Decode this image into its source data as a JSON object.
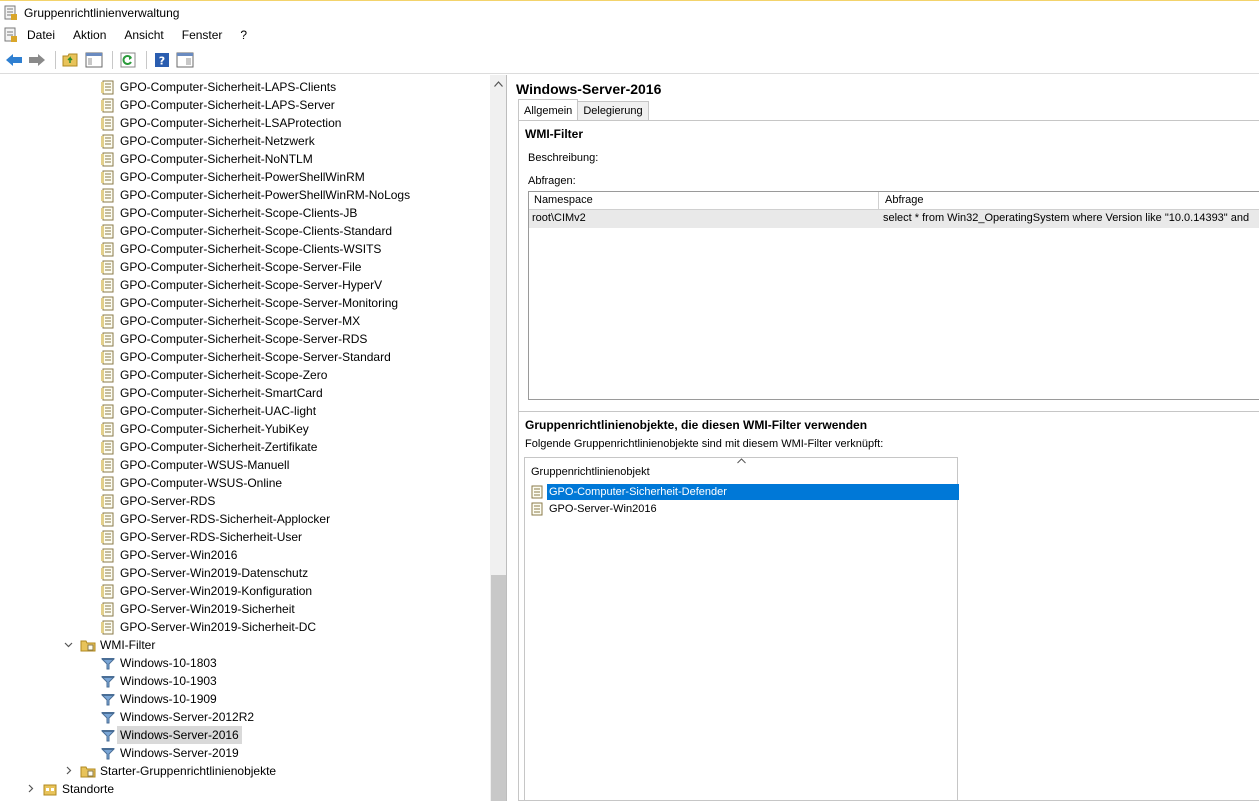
{
  "window": {
    "title": "Gruppenrichtlinienverwaltung"
  },
  "menu": [
    "Datei",
    "Aktion",
    "Ansicht",
    "Fenster",
    "?"
  ],
  "toolbar": {
    "buttons": [
      "back-icon",
      "forward-icon",
      "folder-up-icon",
      "show-hide-tree-icon",
      "refresh-icon",
      "help-icon",
      "properties-pane-icon"
    ]
  },
  "tree": {
    "gpos": [
      "GPO-Computer-Sicherheit-LAPS-Clients",
      "GPO-Computer-Sicherheit-LAPS-Server",
      "GPO-Computer-Sicherheit-LSAProtection",
      "GPO-Computer-Sicherheit-Netzwerk",
      "GPO-Computer-Sicherheit-NoNTLM",
      "GPO-Computer-Sicherheit-PowerShellWinRM",
      "GPO-Computer-Sicherheit-PowerShellWinRM-NoLogs",
      "GPO-Computer-Sicherheit-Scope-Clients-JB",
      "GPO-Computer-Sicherheit-Scope-Clients-Standard",
      "GPO-Computer-Sicherheit-Scope-Clients-WSITS",
      "GPO-Computer-Sicherheit-Scope-Server-File",
      "GPO-Computer-Sicherheit-Scope-Server-HyperV",
      "GPO-Computer-Sicherheit-Scope-Server-Monitoring",
      "GPO-Computer-Sicherheit-Scope-Server-MX",
      "GPO-Computer-Sicherheit-Scope-Server-RDS",
      "GPO-Computer-Sicherheit-Scope-Server-Standard",
      "GPO-Computer-Sicherheit-Scope-Zero",
      "GPO-Computer-Sicherheit-SmartCard",
      "GPO-Computer-Sicherheit-UAC-light",
      "GPO-Computer-Sicherheit-YubiKey",
      "GPO-Computer-Sicherheit-Zertifikate",
      "GPO-Computer-WSUS-Manuell",
      "GPO-Computer-WSUS-Online",
      "GPO-Server-RDS",
      "GPO-Server-RDS-Sicherheit-Applocker",
      "GPO-Server-RDS-Sicherheit-User",
      "GPO-Server-Win2016",
      "GPO-Server-Win2019-Datenschutz",
      "GPO-Server-Win2019-Konfiguration",
      "GPO-Server-Win2019-Sicherheit",
      "GPO-Server-Win2019-Sicherheit-DC"
    ],
    "wmi_folder": "WMI-Filter",
    "wmi_filters": [
      "Windows-10-1803",
      "Windows-10-1903",
      "Windows-10-1909",
      "Windows-Server-2012R2",
      "Windows-Server-2016",
      "Windows-Server-2019"
    ],
    "selected_wmi": "Windows-Server-2016",
    "starter_folder": "Starter-Gruppenrichtlinienobjekte",
    "sites": "Standorte"
  },
  "details": {
    "title": "Windows-Server-2016",
    "tabs": [
      "Allgemein",
      "Delegierung"
    ],
    "active_tab": "Allgemein",
    "section_wmi": "WMI-Filter",
    "description_label": "Beschreibung:",
    "queries_label": "Abfragen:",
    "queries": {
      "columns": [
        "Namespace",
        "Abfrage"
      ],
      "rows": [
        {
          "namespace": "root\\CIMv2",
          "query": "select * from Win32_OperatingSystem where Version like \"10.0.14393\" and"
        }
      ]
    },
    "linked_section": "Gruppenrichtlinienobjekte, die diesen WMI-Filter verwenden",
    "linked_desc": "Folgende Gruppenrichtlinienobjekte sind mit diesem WMI-Filter verknüpft:",
    "linked_list": {
      "column": "Gruppenrichtlinienobjekt",
      "items": [
        "GPO-Computer-Sicherheit-Defender",
        "GPO-Server-Win2016"
      ],
      "selected": "GPO-Computer-Sicherheit-Defender"
    }
  }
}
